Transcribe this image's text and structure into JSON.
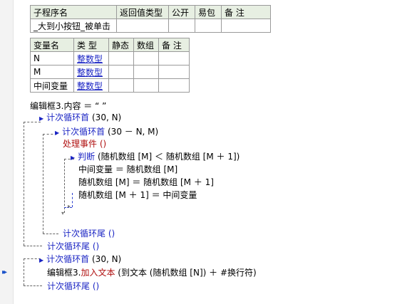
{
  "sub_table": {
    "headers": [
      "子程序名",
      "返回值类型",
      "公开",
      "易包",
      "备 注"
    ],
    "row": [
      "_大到小按钮_被单击",
      "",
      "",
      "",
      ""
    ]
  },
  "var_table": {
    "headers": [
      "变量名",
      "类 型",
      "静态",
      "数组",
      "备 注"
    ],
    "rows": [
      {
        "name": "N",
        "type": "整数型",
        "static": "",
        "array": "",
        "note": ""
      },
      {
        "name": "M",
        "type": "整数型",
        "static": "",
        "array": "",
        "note": ""
      },
      {
        "name": "中间变量",
        "type": "整数型",
        "static": "",
        "array": "",
        "note": ""
      }
    ]
  },
  "code": {
    "l1": "编辑框3.内容 ＝ “ ”",
    "l2_kw": "计次循环首",
    "l2_args": "(30, N)",
    "l3_kw": "计次循环首",
    "l3_args": "(30 － N, M)",
    "l4": "处理事件 ()",
    "l5_kw": "判断",
    "l5_args": "(随机数组 [M] ＜ 随机数组 [M ＋ 1])",
    "l6": "中间变量 ＝ 随机数组 [M]",
    "l7": "随机数组 [M] ＝ 随机数组 [M ＋ 1]",
    "l8": "随机数组 [M ＋ 1] ＝ 中间变量",
    "l9": "计次循环尾 ()",
    "l10": "计次循环尾 ()",
    "l11_kw": "计次循环首",
    "l11_args": "(30, N)",
    "l12_a": "编辑框3.",
    "l12_b": "加入文本",
    "l12_c": "(到文本 (随机数组 [N]) ＋ #换行符)",
    "l13": "计次循环尾 ()"
  },
  "icons": {
    "execution_marker": "execution-arrow-icon",
    "expand_marker": "triangle-right-icon"
  }
}
